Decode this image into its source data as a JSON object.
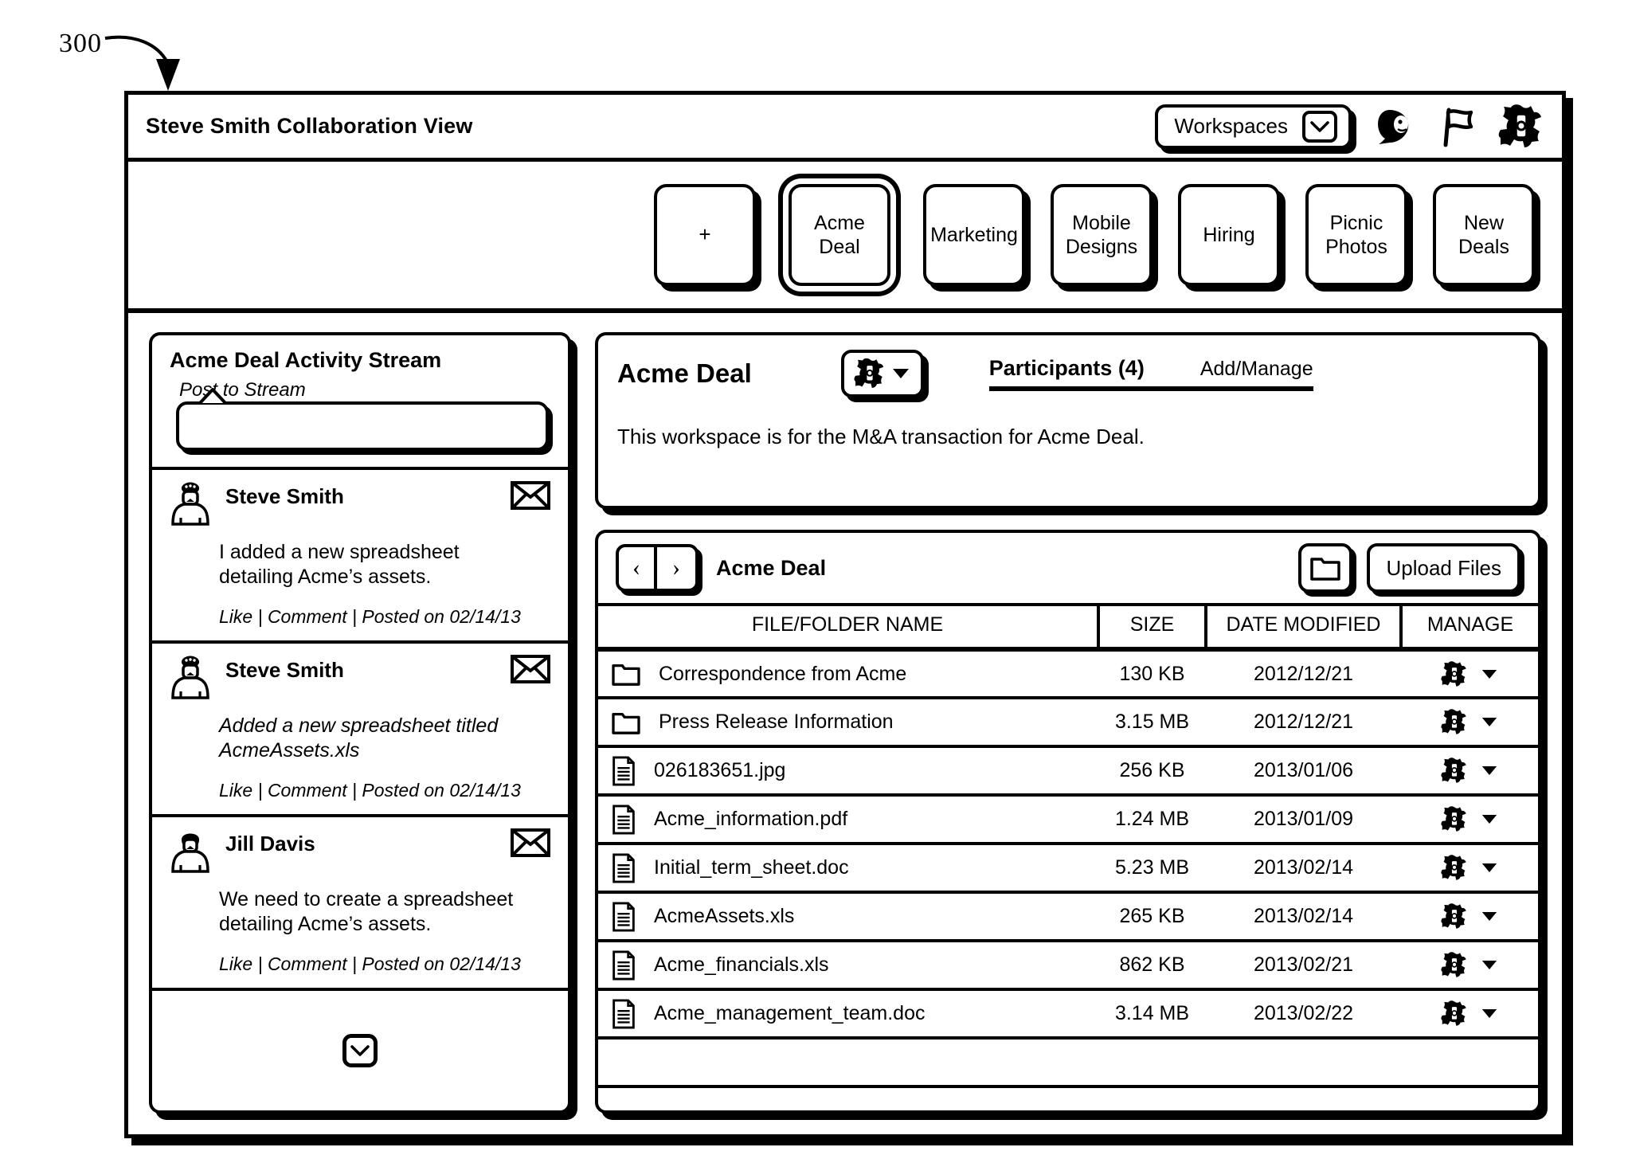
{
  "figure": {
    "ref": "300"
  },
  "titlebar": {
    "app_title": "Steve Smith Collaboration View",
    "workspaces_label": "Workspaces",
    "icons": {
      "chevron": "chevron-down-icon",
      "avatar": "user-avatar-icon",
      "flag": "flag-icon",
      "gear": "gear-icon"
    }
  },
  "tabs": {
    "add_label": "+",
    "items": [
      {
        "label": "Acme\nDeal",
        "selected": true
      },
      {
        "label": "Marketing",
        "selected": false
      },
      {
        "label": "Mobile\nDesigns",
        "selected": false
      },
      {
        "label": "Hiring",
        "selected": false
      },
      {
        "label": "Picnic\nPhotos",
        "selected": false
      },
      {
        "label": "New\nDeals",
        "selected": false
      }
    ]
  },
  "stream": {
    "title": "Acme Deal Activity Stream",
    "post_label": "Post to Stream",
    "compose_placeholder": "",
    "compose_value": "",
    "expand_icon": "chevron-down-icon",
    "posts": [
      {
        "author": "Steve Smith",
        "avatar": "user-avatar-hat-icon",
        "message": "I added a new spreadsheet\ndetailing Acme’s assets.",
        "italic": false,
        "actions": "Like | Comment | Posted on 02/14/13",
        "mail_icon": "envelope-icon"
      },
      {
        "author": "Steve Smith",
        "avatar": "user-avatar-hat-icon",
        "message": "Added a new spreadsheet titled\nAcmeAssets.xls",
        "italic": true,
        "actions": "Like | Comment | Posted on 02/14/13",
        "mail_icon": "envelope-icon"
      },
      {
        "author": "Jill Davis",
        "avatar": "user-avatar-icon",
        "message": "We need to create a spreadsheet\ndetailing Acme’s assets.",
        "italic": false,
        "actions": "Like | Comment | Posted on 02/14/13",
        "mail_icon": "envelope-icon"
      }
    ]
  },
  "workspace_info": {
    "name": "Acme Deal",
    "settings_icon": "gear-icon",
    "settings_caret": "caret-down-icon",
    "participants_label": "Participants (4)",
    "add_manage_label": "Add/Manage",
    "description": "This workspace is for the M&A transaction for Acme Deal."
  },
  "files": {
    "back_label": "‹",
    "forward_label": "›",
    "breadcrumb": "Acme Deal",
    "new_folder_icon": "folder-icon",
    "upload_label": "Upload Files",
    "columns": [
      "FILE/FOLDER NAME",
      "SIZE",
      "DATE MODIFIED",
      "MANAGE"
    ],
    "rows": [
      {
        "icon": "folder-icon",
        "name": "Correspondence from Acme",
        "size": "130 KB",
        "date": "2012/12/21",
        "manage_icon": "gear-icon",
        "manage_caret": "caret-down-icon"
      },
      {
        "icon": "folder-icon",
        "name": "Press Release Information",
        "size": "3.15 MB",
        "date": "2012/12/21",
        "manage_icon": "gear-icon",
        "manage_caret": "caret-down-icon"
      },
      {
        "icon": "document-icon",
        "name": "026183651.jpg",
        "size": "256 KB",
        "date": "2013/01/06",
        "manage_icon": "gear-icon",
        "manage_caret": "caret-down-icon"
      },
      {
        "icon": "document-icon",
        "name": "Acme_information.pdf",
        "size": "1.24 MB",
        "date": "2013/01/09",
        "manage_icon": "gear-icon",
        "manage_caret": "caret-down-icon"
      },
      {
        "icon": "document-icon",
        "name": "Initial_term_sheet.doc",
        "size": "5.23 MB",
        "date": "2013/02/14",
        "manage_icon": "gear-icon",
        "manage_caret": "caret-down-icon"
      },
      {
        "icon": "document-icon",
        "name": "AcmeAssets.xls",
        "size": "265 KB",
        "date": "2013/02/14",
        "manage_icon": "gear-icon",
        "manage_caret": "caret-down-icon"
      },
      {
        "icon": "document-icon",
        "name": "Acme_financials.xls",
        "size": "862 KB",
        "date": "2013/02/21",
        "manage_icon": "gear-icon",
        "manage_caret": "caret-down-icon"
      },
      {
        "icon": "document-icon",
        "name": "Acme_management_team.doc",
        "size": "3.14 MB",
        "date": "2013/02/22",
        "manage_icon": "gear-icon",
        "manage_caret": "caret-down-icon"
      }
    ]
  },
  "colors": {
    "ink": "#000000",
    "paper": "#ffffff"
  }
}
